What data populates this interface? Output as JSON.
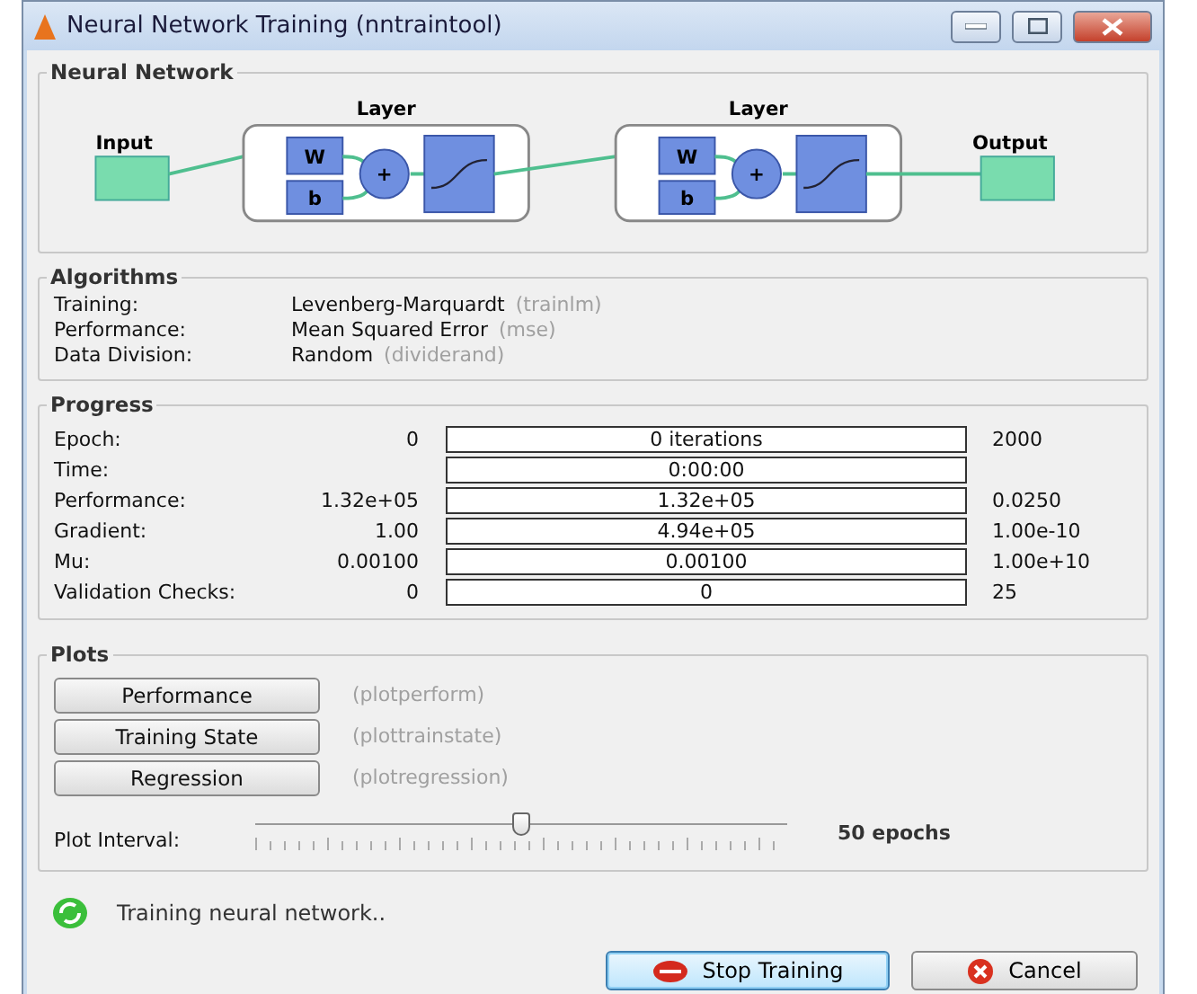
{
  "window": {
    "title": "Neural Network Training (nntraintool)"
  },
  "network": {
    "title": "Neural Network",
    "input_label": "Input",
    "output_label": "Output",
    "layers": [
      {
        "label": "Layer",
        "weight": "W",
        "bias": "b",
        "sum_symbol": "+"
      },
      {
        "label": "Layer",
        "weight": "W",
        "bias": "b",
        "sum_symbol": "+"
      }
    ]
  },
  "algorithms": {
    "title": "Algorithms",
    "rows": [
      {
        "label": "Training:",
        "value": "Levenberg-Marquardt",
        "function": "(trainlm)"
      },
      {
        "label": "Performance:",
        "value": "Mean Squared Error",
        "function": "(mse)"
      },
      {
        "label": "Data Division:",
        "value": "Random",
        "function": "(dividerand)"
      }
    ]
  },
  "progress": {
    "title": "Progress",
    "rows": [
      {
        "label": "Epoch:",
        "start": "0",
        "reading": "0 iterations",
        "level": 0,
        "end": "2000"
      },
      {
        "label": "Time:",
        "reading": "0:00:00",
        "level": 0
      },
      {
        "label": "Performance:",
        "start": "1.32e+05",
        "reading": "1.32e+05",
        "level": 0,
        "end": "0.0250"
      },
      {
        "label": "Gradient:",
        "start": "1.00",
        "reading": "4.94e+05",
        "level": 0,
        "end": "1.00e-10"
      },
      {
        "label": "Mu:",
        "start": "0.00100",
        "reading": "0.00100",
        "level": 0,
        "end": "1.00e+10"
      },
      {
        "label": "Validation Checks:",
        "start": "0",
        "reading": "0",
        "level": 0,
        "end": "25"
      }
    ]
  },
  "plots": {
    "title": "Plots",
    "buttons": [
      {
        "label": "Performance",
        "function": "(plotperform)"
      },
      {
        "label": "Training State",
        "function": "(plottrainstate)"
      },
      {
        "label": "Regression",
        "function": "(plotregression)"
      }
    ],
    "interval": {
      "label": "Plot Interval:",
      "level": 0.5,
      "reading": "50 epochs"
    }
  },
  "status": {
    "text": "Training neural network.."
  },
  "buttons": [
    {
      "kind": "stop",
      "label": "Stop Training",
      "focused": true
    },
    {
      "kind": "cancel",
      "label": "Cancel",
      "focused": false
    }
  ]
}
